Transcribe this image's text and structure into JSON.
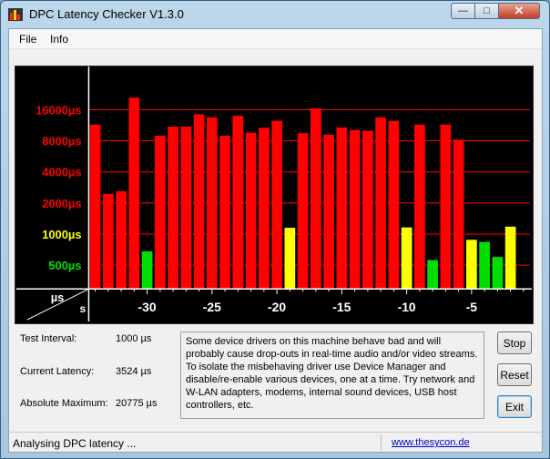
{
  "window": {
    "title": "DPC Latency Checker V1.3.0"
  },
  "menu": {
    "file": "File",
    "info": "Info"
  },
  "chart_data": {
    "type": "bar",
    "ytick_labels": [
      {
        "label": "16000µs",
        "color": "#ff0000"
      },
      {
        "label": "8000µs",
        "color": "#ff0000"
      },
      {
        "label": "4000µs",
        "color": "#ff0000"
      },
      {
        "label": "2000µs",
        "color": "#ff0000"
      },
      {
        "label": "1000µs",
        "color": "#ffff00"
      },
      {
        "label": "500µs",
        "color": "#00e000"
      }
    ],
    "ytick_values": [
      16000,
      8000,
      4000,
      2000,
      1000,
      500
    ],
    "xtick_labels": [
      "-30",
      "-25",
      "-20",
      "-15",
      "-10",
      "-5"
    ],
    "xtick_values": [
      -30,
      -25,
      -20,
      -15,
      -10,
      -5
    ],
    "xlim": [
      -34.5,
      -0.5
    ],
    "ylim_log2": [
      8.2,
      15.3
    ],
    "corner_labels": {
      "y_unit": "µs",
      "x_unit": "s"
    },
    "colors": {
      "red": "#ff0000",
      "yellow": "#ffff00",
      "green": "#00dd00",
      "grid": "#ff0000",
      "background": "#000000"
    },
    "bars": [
      {
        "x": -34,
        "y": 11500,
        "color": "red"
      },
      {
        "x": -33,
        "y": 2450,
        "color": "red"
      },
      {
        "x": -32,
        "y": 2600,
        "color": "red"
      },
      {
        "x": -31,
        "y": 21000,
        "color": "red"
      },
      {
        "x": -30,
        "y": 680,
        "color": "green"
      },
      {
        "x": -29,
        "y": 9000,
        "color": "red"
      },
      {
        "x": -28,
        "y": 11000,
        "color": "red"
      },
      {
        "x": -27,
        "y": 11000,
        "color": "red"
      },
      {
        "x": -26,
        "y": 14500,
        "color": "red"
      },
      {
        "x": -25,
        "y": 13500,
        "color": "red"
      },
      {
        "x": -24,
        "y": 9000,
        "color": "red"
      },
      {
        "x": -23,
        "y": 14000,
        "color": "red"
      },
      {
        "x": -22,
        "y": 9600,
        "color": "red"
      },
      {
        "x": -21,
        "y": 10700,
        "color": "red"
      },
      {
        "x": -20,
        "y": 12500,
        "color": "red"
      },
      {
        "x": -19,
        "y": 1150,
        "color": "yellow"
      },
      {
        "x": -18,
        "y": 9500,
        "color": "red"
      },
      {
        "x": -17,
        "y": 16500,
        "color": "red"
      },
      {
        "x": -16,
        "y": 9200,
        "color": "red"
      },
      {
        "x": -15,
        "y": 10800,
        "color": "red"
      },
      {
        "x": -14,
        "y": 10200,
        "color": "red"
      },
      {
        "x": -13,
        "y": 10000,
        "color": "red"
      },
      {
        "x": -12,
        "y": 13500,
        "color": "red"
      },
      {
        "x": -11,
        "y": 12500,
        "color": "red"
      },
      {
        "x": -10,
        "y": 1160,
        "color": "yellow"
      },
      {
        "x": -9,
        "y": 11500,
        "color": "red"
      },
      {
        "x": -8,
        "y": 560,
        "color": "green"
      },
      {
        "x": -7,
        "y": 11500,
        "color": "red"
      },
      {
        "x": -6,
        "y": 8200,
        "color": "red"
      },
      {
        "x": -5,
        "y": 880,
        "color": "yellow"
      },
      {
        "x": -4,
        "y": 840,
        "color": "green"
      },
      {
        "x": -3,
        "y": 600,
        "color": "green"
      },
      {
        "x": -2,
        "y": 1180,
        "color": "yellow"
      }
    ]
  },
  "info": {
    "test_interval_label": "Test Interval:",
    "test_interval_value": "1000 µs",
    "current_latency_label": "Current Latency:",
    "current_latency_value": "3524 µs",
    "absolute_maximum_label": "Absolute Maximum:",
    "absolute_maximum_value": "20775 µs"
  },
  "message": "Some device drivers on this machine behave bad and will probably cause drop-outs in real-time audio and/or video streams. To isolate the misbehaving driver use Device Manager and disable/re-enable various devices, one at a time. Try network and W-LAN adapters, modems, internal sound devices, USB host controllers, etc.",
  "buttons": {
    "stop": "Stop",
    "reset": "Reset",
    "exit": "Exit"
  },
  "status": {
    "text": "Analysing DPC latency ...",
    "link": "www.thesycon.de"
  }
}
